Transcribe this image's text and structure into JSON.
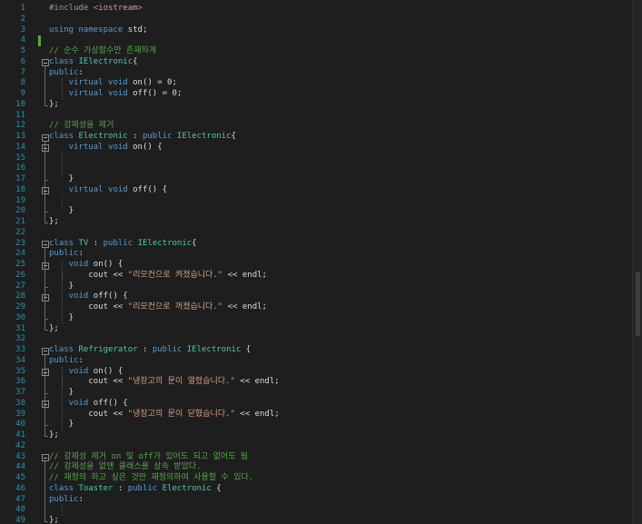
{
  "editor": {
    "line_numbers": [
      "1",
      "2",
      "3",
      "4",
      "5",
      "6",
      "7",
      "8",
      "9",
      "10",
      "11",
      "12",
      "13",
      "14",
      "15",
      "16",
      "17",
      "18",
      "19",
      "20",
      "21",
      "22",
      "23",
      "24",
      "25",
      "26",
      "27",
      "28",
      "29",
      "30",
      "31",
      "32",
      "33",
      "34",
      "35",
      "36",
      "37",
      "38",
      "39",
      "40",
      "41",
      "42",
      "43",
      "44",
      "45",
      "46",
      "47",
      "48",
      "49"
    ],
    "lines": [
      [
        {
          "t": "#include <",
          "c": "pp"
        },
        {
          "t": "iostream",
          "c": "inc"
        },
        {
          "t": ">",
          "c": "pp"
        }
      ],
      [],
      [
        {
          "t": "using namespace ",
          "c": "kw"
        },
        {
          "t": "std",
          "c": ""
        },
        {
          "t": ";",
          "c": ""
        }
      ],
      [],
      [
        {
          "t": "// 순수 가상함수만 존재하게",
          "c": "cm"
        }
      ],
      [
        {
          "t": "class ",
          "c": "kw"
        },
        {
          "t": "IElectronic",
          "c": "type"
        },
        {
          "t": "{",
          "c": ""
        }
      ],
      [
        {
          "t": "public",
          "c": "kw"
        },
        {
          "t": ":",
          "c": ""
        }
      ],
      [
        {
          "t": "    virtual void ",
          "c": "kw"
        },
        {
          "t": "on() = 0;",
          "c": ""
        }
      ],
      [
        {
          "t": "    virtual void ",
          "c": "kw"
        },
        {
          "t": "off() = 0;",
          "c": ""
        }
      ],
      [
        {
          "t": "};",
          "c": ""
        }
      ],
      [],
      [
        {
          "t": "// 강제성을 제거",
          "c": "cm"
        }
      ],
      [
        {
          "t": "class ",
          "c": "kw"
        },
        {
          "t": "Electronic",
          "c": "type"
        },
        {
          "t": " : ",
          "c": ""
        },
        {
          "t": "public ",
          "c": "kw"
        },
        {
          "t": "IElectronic",
          "c": "type"
        },
        {
          "t": "{",
          "c": ""
        }
      ],
      [
        {
          "t": "    virtual void ",
          "c": "kw"
        },
        {
          "t": "on() {",
          "c": ""
        }
      ],
      [],
      [],
      [
        {
          "t": "    }",
          "c": ""
        }
      ],
      [
        {
          "t": "    virtual void ",
          "c": "kw"
        },
        {
          "t": "off() {",
          "c": ""
        }
      ],
      [],
      [
        {
          "t": "    }",
          "c": ""
        }
      ],
      [
        {
          "t": "};",
          "c": ""
        }
      ],
      [],
      [
        {
          "t": "class ",
          "c": "kw"
        },
        {
          "t": "TV",
          "c": "type"
        },
        {
          "t": " : ",
          "c": ""
        },
        {
          "t": "public ",
          "c": "kw"
        },
        {
          "t": "IElectronic",
          "c": "type"
        },
        {
          "t": "{",
          "c": ""
        }
      ],
      [
        {
          "t": "public",
          "c": "kw"
        },
        {
          "t": ":",
          "c": ""
        }
      ],
      [
        {
          "t": "    void ",
          "c": "kw"
        },
        {
          "t": "on() {",
          "c": ""
        }
      ],
      [
        {
          "t": "        cout << ",
          "c": ""
        },
        {
          "t": "\"리모컨으로 켜졌습니다.\"",
          "c": "str"
        },
        {
          "t": " << endl;",
          "c": ""
        }
      ],
      [
        {
          "t": "    }",
          "c": ""
        }
      ],
      [
        {
          "t": "    void ",
          "c": "kw"
        },
        {
          "t": "off() {",
          "c": ""
        }
      ],
      [
        {
          "t": "        cout << ",
          "c": ""
        },
        {
          "t": "\"리모컨으로 꺼졌습니다.\"",
          "c": "str"
        },
        {
          "t": " << endl;",
          "c": ""
        }
      ],
      [
        {
          "t": "    }",
          "c": ""
        }
      ],
      [
        {
          "t": "};",
          "c": ""
        }
      ],
      [],
      [
        {
          "t": "class ",
          "c": "kw"
        },
        {
          "t": "Refrigerator",
          "c": "type"
        },
        {
          "t": " : ",
          "c": ""
        },
        {
          "t": "public ",
          "c": "kw"
        },
        {
          "t": "IElectronic",
          "c": "type"
        },
        {
          "t": " {",
          "c": ""
        }
      ],
      [
        {
          "t": "public",
          "c": "kw"
        },
        {
          "t": ":",
          "c": ""
        }
      ],
      [
        {
          "t": "    void ",
          "c": "kw"
        },
        {
          "t": "on() {",
          "c": ""
        }
      ],
      [
        {
          "t": "        cout << ",
          "c": ""
        },
        {
          "t": "\"냉장고의 문이 열렸습니다.\"",
          "c": "str"
        },
        {
          "t": " << endl;",
          "c": ""
        }
      ],
      [
        {
          "t": "    }",
          "c": ""
        }
      ],
      [
        {
          "t": "    void ",
          "c": "kw"
        },
        {
          "t": "off() {",
          "c": ""
        }
      ],
      [
        {
          "t": "        cout << ",
          "c": ""
        },
        {
          "t": "\"냉장고의 문이 닫혔습니다.\"",
          "c": "str"
        },
        {
          "t": " << endl;",
          "c": ""
        }
      ],
      [
        {
          "t": "    }",
          "c": ""
        }
      ],
      [
        {
          "t": "};",
          "c": ""
        }
      ],
      [],
      [
        {
          "t": "// 강제성 제거 on 및 off가 있어도 되고 없어도 됨",
          "c": "cm"
        }
      ],
      [
        {
          "t": "// 강제성을 없앤 클래스를 상속 받았다.",
          "c": "cm"
        }
      ],
      [
        {
          "t": "// 재정의 하고 싶은 것만 재정의하여 사용할 수 있다.",
          "c": "cm"
        }
      ],
      [
        {
          "t": "class ",
          "c": "kw"
        },
        {
          "t": "Toaster",
          "c": "type"
        },
        {
          "t": " : ",
          "c": ""
        },
        {
          "t": "public ",
          "c": "kw"
        },
        {
          "t": "Electronic",
          "c": "type"
        },
        {
          "t": " {",
          "c": ""
        }
      ],
      [
        {
          "t": "public",
          "c": "kw"
        },
        {
          "t": ":",
          "c": ""
        }
      ],
      [],
      [
        {
          "t": "};",
          "c": ""
        }
      ]
    ]
  },
  "colors": {
    "background": "#1e1e1e",
    "keyword": "#569cd6",
    "comment": "#57a64a",
    "string": "#d69d85",
    "type": "#4ec9b0",
    "line_number": "#2b91af"
  },
  "icons": {
    "fold": "collapse-box-icon"
  }
}
